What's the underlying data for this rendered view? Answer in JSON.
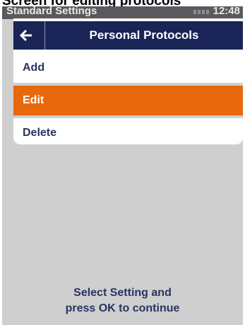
{
  "caption": {
    "text": "Screen for editing protocols"
  },
  "status_bar": {
    "title": "Standard Settings",
    "time": "12:48"
  },
  "header": {
    "title": "Personal Protocols",
    "back_icon": "arrow-left-icon"
  },
  "menu": {
    "items": [
      {
        "label": "Add",
        "selected": false
      },
      {
        "label": "Edit",
        "selected": true
      },
      {
        "label": "Delete",
        "selected": false
      }
    ]
  },
  "hint": {
    "line1": "Select Setting and",
    "line2": "press OK to continue"
  },
  "colors": {
    "header_bg": "#1a2456",
    "selected_bg": "#e8680c",
    "text": "#2a3460",
    "screen_bg": "#cfcfcf"
  }
}
